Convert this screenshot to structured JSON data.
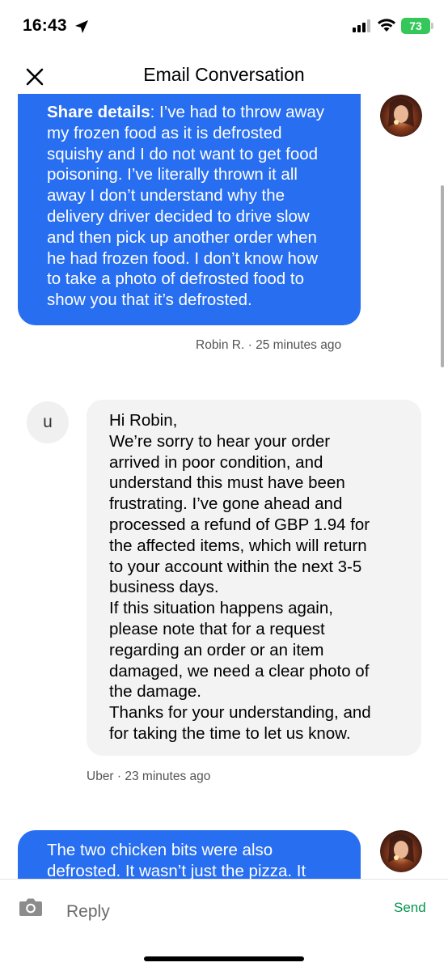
{
  "status_bar": {
    "time": "16:43",
    "battery": "73",
    "icons": [
      "location-arrow-icon",
      "signal-icon",
      "wifi-icon",
      "battery-icon"
    ]
  },
  "header": {
    "title": "Email Conversation",
    "close_icon": "close-icon"
  },
  "messages": [
    {
      "sender": "user",
      "lines": [
        {
          "bold": "Share details",
          "text": ": I’ve had to throw away"
        },
        {
          "text": "my frozen food as it is defrosted"
        },
        {
          "text": "squishy and I do not want to get food"
        },
        {
          "text": "poisoning. I’ve literally thrown it all"
        },
        {
          "text": "away I don’t understand why the"
        },
        {
          "text": "delivery driver decided to drive slow"
        },
        {
          "text": "and then pick up another order when"
        },
        {
          "text": "he had frozen food. I don’t know how"
        },
        {
          "text": "to take a photo of defrosted food to"
        },
        {
          "text": "show you that it’s defrosted."
        }
      ],
      "meta": "Robin R. · 25 minutes ago"
    },
    {
      "sender": "uber",
      "avatar_letter": "u",
      "lines": [
        "Hi Robin,",
        "We’re sorry to hear your order",
        "arrived in poor condition, and",
        "understand this must have been",
        "frustrating. I’ve gone ahead and",
        "processed a refund of GBP 1.94 for",
        "the affected items, which will return",
        "to your account within the next 3-5",
        "business days.",
        "If this situation happens again,",
        "please note that for a request",
        "regarding an order or an item",
        "damaged, we need a clear photo of",
        "the damage.",
        "Thanks for your understanding, and",
        "for taking the time to let us know."
      ],
      "meta": "Uber · 23 minutes ago"
    },
    {
      "sender": "user",
      "lines": [
        "The two chicken bits were also",
        "defrosted. It wasn’t just the pizza. It"
      ]
    }
  ],
  "composer": {
    "placeholder": "Reply",
    "send_label": "Send",
    "camera_icon": "camera-icon"
  },
  "colors": {
    "outgoing_bubble": "#276ef1",
    "incoming_bubble": "#f3f3f3",
    "send": "#05944f",
    "battery": "#34c759"
  }
}
